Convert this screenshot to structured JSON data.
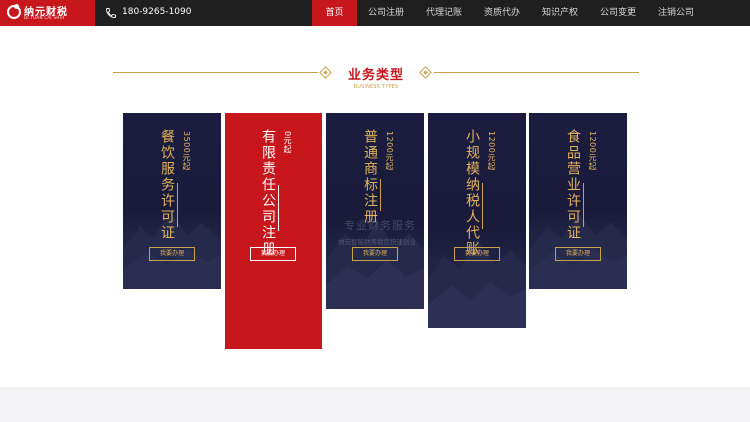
{
  "header": {
    "logo_text": "纳元财税",
    "logo_sub": "DI YUAN CAI SHUI",
    "phone": "180-9265-1090"
  },
  "nav": {
    "items": [
      {
        "label": "首页",
        "active": true
      },
      {
        "label": "公司注册",
        "active": false
      },
      {
        "label": "代理记账",
        "active": false
      },
      {
        "label": "资质代办",
        "active": false
      },
      {
        "label": "知识产权",
        "active": false
      },
      {
        "label": "公司变更",
        "active": false
      },
      {
        "label": "注销公司",
        "active": false
      }
    ]
  },
  "section": {
    "title": "业务类型",
    "subtitle": "BUSINESS TYPES"
  },
  "cards": [
    {
      "title": "餐饮服务许可证",
      "price": "3500元起",
      "button": "我要办理"
    },
    {
      "title": "有限责任公司注册",
      "price": "0元起",
      "button": "我要办理"
    },
    {
      "title": "普通商标注册",
      "price": "1200元起",
      "button": "我要办理"
    },
    {
      "title": "小规模纳税人代账",
      "price": "1200元起",
      "button": "我要办理"
    },
    {
      "title": "食品营业许可证",
      "price": "1200元起",
      "button": "我要办理"
    }
  ],
  "overlay": {
    "line1": "专业财务服务",
    "line2": "纳元智能财务助您快速创业"
  },
  "colors": {
    "brand_red": "#c8161d",
    "gold": "#c9a14a",
    "navy": "#1b1c3f",
    "topbar": "#1f1f1f"
  }
}
